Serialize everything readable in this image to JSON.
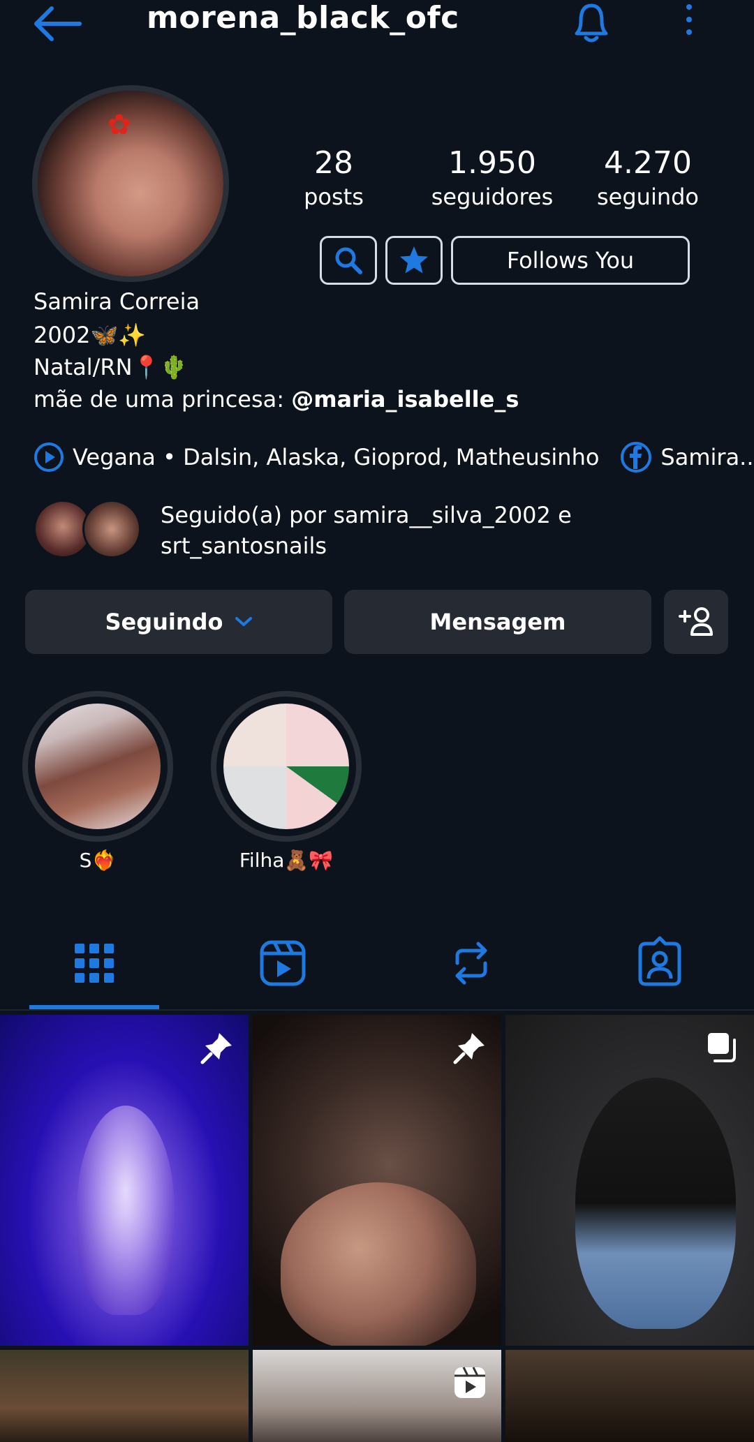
{
  "header": {
    "username": "morena_black_ofc",
    "back_icon": "arrow-left-icon",
    "bell_icon": "bell-icon",
    "menu_icon": "kebab-menu-icon",
    "accent": "#1e7ae0"
  },
  "stats": {
    "posts_count": "28",
    "posts_label": "posts",
    "followers_count": "1.950",
    "followers_label": "seguidores",
    "following_count": "4.270",
    "following_label": "seguindo"
  },
  "chips": {
    "search_icon": "search-icon",
    "star_icon": "star-icon",
    "follows_you": "Follows You"
  },
  "bio": {
    "name": "Samira Correia",
    "line1": "2002🦋✨",
    "line2": "Natal/RN📍🌵",
    "line3_prefix": "mãe de uma princesa: ",
    "line3_mention": "@maria_isabelle_s"
  },
  "links": {
    "music": "Vegana • Dalsin, Alaska, Gioprod, Matheusinho",
    "facebook": "Samira..."
  },
  "followed_by": {
    "text": "Seguido(a) por samira__silva_2002 e srt_santosnails"
  },
  "actions": {
    "following": "Seguindo",
    "message": "Mensagem",
    "add_user_icon": "add-user-icon"
  },
  "highlights": [
    {
      "label": "S❤️‍🔥"
    },
    {
      "label": "Filha🧸🎀"
    }
  ],
  "tabs": [
    "grid-icon",
    "reels-icon",
    "reposts-icon",
    "tagged-icon"
  ]
}
